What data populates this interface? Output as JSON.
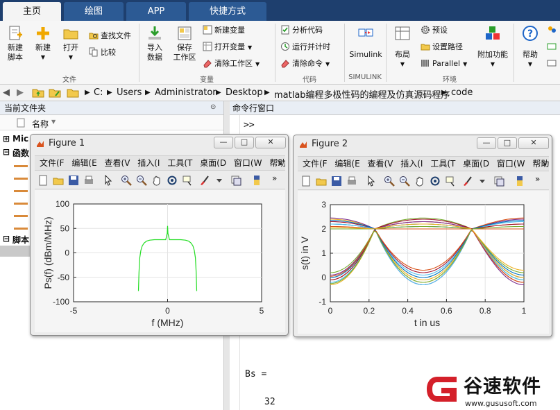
{
  "tabs": [
    {
      "label": "主页",
      "active": true
    },
    {
      "label": "绘图",
      "active": false
    },
    {
      "label": "APP",
      "active": false
    },
    {
      "label": "快捷方式",
      "active": false
    }
  ],
  "ribbon": {
    "file": {
      "group": "文件",
      "new_script": "新建\n脚本",
      "new": "新建",
      "open": "打开",
      "find_files": "查找文件",
      "compare": "比较"
    },
    "variable": {
      "group": "变量",
      "import_data": "导入\n数据",
      "save_workspace": "保存\n工作区",
      "new_variable": "新建变量",
      "open_variable": "打开变量",
      "clear_workspace": "清除工作区"
    },
    "code": {
      "group": "代码",
      "analyze_code": "分析代码",
      "run_and_time": "运行并计时",
      "clear_commands": "清除命令"
    },
    "simulink": {
      "group": "SIMULINK",
      "label": "Simulink"
    },
    "environment": {
      "group": "环境",
      "layout": "布局",
      "preferences": "预设",
      "set_path": "设置路径",
      "parallel": "Parallel",
      "addons": "附加功能"
    },
    "resources": {
      "help": "帮助"
    }
  },
  "address": {
    "segments": [
      "C:",
      "Users",
      "Administrator",
      "Desktop",
      "matlab编程多极性码的编程及仿真源码程序",
      "code"
    ]
  },
  "left_pane": {
    "title": "当前文件夹",
    "column": "名称",
    "items": [
      "Mic",
      "函数",
      "脚本"
    ]
  },
  "command_window": {
    "title": "命令行窗口",
    "prompt": ">>",
    "output_var": "Bs =",
    "output_value": "32"
  },
  "figure_menu": [
    "文件(F",
    "编辑(E",
    "查看(V",
    "插入(I",
    "工具(T",
    "桌面(D",
    "窗口(W",
    "帮助(H"
  ],
  "figure_buttons": {
    "min": "—",
    "max": "□",
    "close": "✕",
    "more": "»"
  },
  "figure1": {
    "title": "Figure 1",
    "chart_data": {
      "type": "line",
      "xlabel": "f (MHz)",
      "ylabel": "Ps(f)  (dBm/MHz)",
      "xlim": [
        -5,
        5
      ],
      "ylim": [
        -100,
        100
      ],
      "xticks": [
        -5,
        0,
        5
      ],
      "yticks": [
        -100,
        -50,
        0,
        50,
        100
      ],
      "grid": true,
      "series": [
        {
          "color": "#22dd22",
          "x": [
            -1.55,
            -1.52,
            -1.48,
            -1.42,
            -1.35,
            -1.25,
            -1.12,
            -0.95,
            -0.7,
            -0.4,
            -0.1,
            -0.02,
            0.0,
            0.02,
            0.1,
            0.4,
            0.7,
            0.95,
            1.12,
            1.25,
            1.35,
            1.42,
            1.48,
            1.52,
            1.55
          ],
          "y": [
            -78,
            -40,
            -10,
            5,
            14,
            20,
            24,
            26,
            27,
            27,
            27,
            40,
            55,
            40,
            27,
            27,
            27,
            26,
            24,
            20,
            14,
            5,
            -10,
            -40,
            -78
          ]
        }
      ]
    }
  },
  "figure2": {
    "title": "Figure 2",
    "chart_data": {
      "type": "line",
      "xlabel": "t in us",
      "ylabel": "s(t) in V",
      "xlim": [
        0,
        1
      ],
      "ylim": [
        -1,
        3
      ],
      "xticks": [
        0,
        0.2,
        0.4,
        0.6,
        0.8,
        1
      ],
      "yticks": [
        -1,
        0,
        1,
        2,
        3
      ],
      "grid": true,
      "crossings": [
        0.23,
        0.73
      ],
      "series": [
        {
          "color": "#0072bd",
          "levels": [
            2.2,
            2.1,
            0.0
          ]
        },
        {
          "color": "#d95319",
          "levels": [
            -0.1,
            2.3,
            2.0
          ]
        },
        {
          "color": "#edb120",
          "levels": [
            2.4,
            -0.2,
            2.2
          ]
        },
        {
          "color": "#7e2f8e",
          "levels": [
            0.1,
            -0.3,
            2.4
          ]
        },
        {
          "color": "#77ac30",
          "levels": [
            2.0,
            2.45,
            -0.1
          ]
        },
        {
          "color": "#4dbeee",
          "levels": [
            -0.2,
            0.1,
            2.3
          ]
        },
        {
          "color": "#a2142f",
          "levels": [
            2.3,
            0.2,
            -0.2
          ]
        },
        {
          "color": "#0072bd",
          "levels": [
            0.0,
            2.2,
            0.1
          ]
        },
        {
          "color": "#d95319",
          "levels": [
            2.1,
            2.0,
            2.45
          ]
        },
        {
          "color": "#edb120",
          "levels": [
            -0.3,
            -0.1,
            0.0
          ]
        },
        {
          "color": "#7e2f8e",
          "levels": [
            2.45,
            2.3,
            -0.3
          ]
        },
        {
          "color": "#77ac30",
          "levels": [
            0.2,
            2.1,
            0.2
          ]
        },
        {
          "color": "#4dbeee",
          "levels": [
            2.2,
            -0.3,
            -0.1
          ]
        },
        {
          "color": "#a2142f",
          "levels": [
            -0.1,
            2.4,
            2.2
          ]
        },
        {
          "color": "#0072bd",
          "levels": [
            2.35,
            0.0,
            2.35
          ]
        },
        {
          "color": "#d95319",
          "levels": [
            0.05,
            0.3,
            -0.2
          ]
        },
        {
          "color": "#edb120",
          "levels": [
            2.05,
            2.2,
            0.3
          ]
        },
        {
          "color": "#77ac30",
          "levels": [
            -0.25,
            -0.2,
            2.1
          ]
        }
      ]
    }
  },
  "watermark": {
    "brand": "谷速软件",
    "url": "www.gususoft.com"
  },
  "colors": {
    "tabbar": "#1e3f6e",
    "accent_green": "#22dd22"
  }
}
